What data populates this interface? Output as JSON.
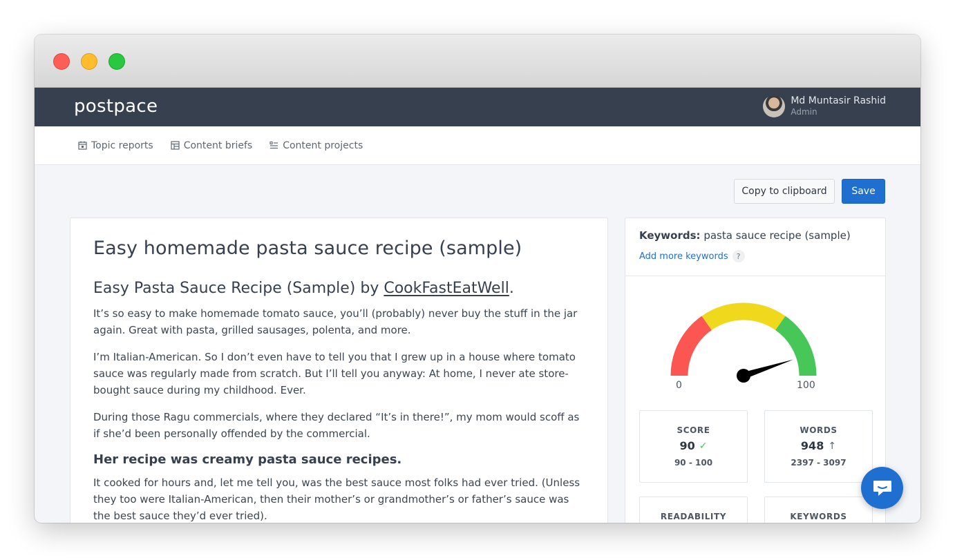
{
  "app": {
    "logo": "postpace",
    "user": {
      "name": "Md Muntasir Rashid",
      "role": "Admin"
    }
  },
  "nav": {
    "items": [
      {
        "label": "Topic reports",
        "icon": "calendar-icon"
      },
      {
        "label": "Content briefs",
        "icon": "brief-icon"
      },
      {
        "label": "Content projects",
        "icon": "list-icon"
      }
    ]
  },
  "toolbar": {
    "copy_label": "Copy to clipboard",
    "save_label": "Save"
  },
  "editor": {
    "title": "Easy homemade pasta sauce recipe (sample)",
    "heading1_text": "Easy Pasta Sauce Recipe (Sample) by ",
    "heading1_link": "CookFastEatWell",
    "heading1_end": ".",
    "p1": "It’s so easy to make homemade tomato sauce, you’ll (probably) never buy the stuff in the jar again. Great with pasta, grilled sausages, polenta, and more.",
    "p2": "I’m Italian-American. So I don’t even have to tell you that I grew up in a house where tomato sauce was regularly made from scratch. But I’ll tell you anyway: At home, I never ate store-bought sauce during my childhood. Ever.",
    "p3": "During those Ragu commercials, where they declared “It’s in there!”, my mom would scoff as if she’d been personally offended by the commercial.",
    "heading2": "Her recipe was creamy pasta sauce recipes.",
    "p4": "It cooked for hours and, let me tell you, was the best sauce most folks had ever tried. (Unless they too were Italian-American, then their mother’s or grandmother’s or father’s sauce was the best sauce they’d ever tried)."
  },
  "sidebar": {
    "keywords_label": "Keywords:",
    "keywords_value": "pasta sauce recipe (sample)",
    "add_keywords": "Add more keywords",
    "help": "?",
    "gauge": {
      "min_label": "0",
      "max_label": "100",
      "value": 90,
      "colors": [
        "#fc5652",
        "#f0d91c",
        "#46c757"
      ]
    },
    "stats": [
      {
        "label": "SCORE",
        "value": "90",
        "icon": "check-icon",
        "range": "90 - 100"
      },
      {
        "label": "WORDS",
        "value": "948",
        "icon": "arrow-up-icon",
        "range": "2397 - 3097"
      },
      {
        "label": "READABILITY",
        "value": "",
        "range": ""
      },
      {
        "label": "KEYWORDS",
        "value": "",
        "range": ""
      }
    ]
  },
  "colors": {
    "accent": "#1f6fd0",
    "topbar": "#36404f",
    "success": "#46c757"
  }
}
